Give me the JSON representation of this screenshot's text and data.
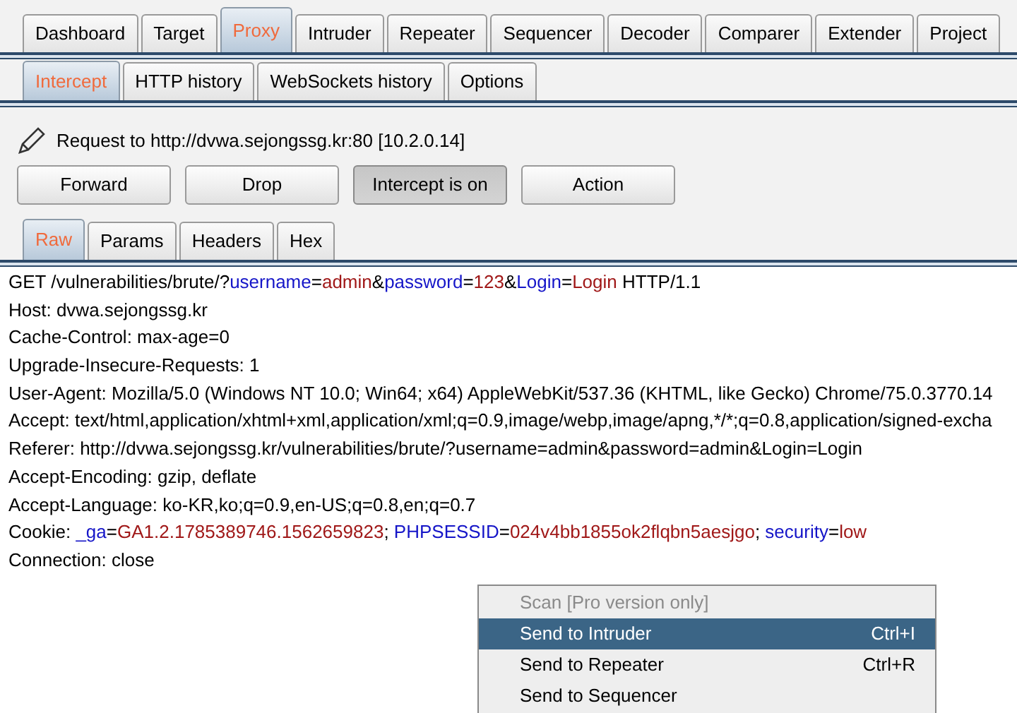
{
  "main_tabs": [
    {
      "label": "Dashboard",
      "selected": false
    },
    {
      "label": "Target",
      "selected": false
    },
    {
      "label": "Proxy",
      "selected": true
    },
    {
      "label": "Intruder",
      "selected": false
    },
    {
      "label": "Repeater",
      "selected": false
    },
    {
      "label": "Sequencer",
      "selected": false
    },
    {
      "label": "Decoder",
      "selected": false
    },
    {
      "label": "Comparer",
      "selected": false
    },
    {
      "label": "Extender",
      "selected": false
    },
    {
      "label": "Project",
      "selected": false
    }
  ],
  "proxy_tabs": [
    {
      "label": "Intercept",
      "selected": true
    },
    {
      "label": "HTTP history",
      "selected": false
    },
    {
      "label": "WebSockets history",
      "selected": false
    },
    {
      "label": "Options",
      "selected": false
    }
  ],
  "request_info": "Request to http://dvwa.sejongssg.kr:80  [10.2.0.14]",
  "buttons": [
    {
      "label": "Forward",
      "pressed": false
    },
    {
      "label": "Drop",
      "pressed": false
    },
    {
      "label": "Intercept is on",
      "pressed": true
    },
    {
      "label": "Action",
      "pressed": false
    }
  ],
  "editor_tabs": [
    {
      "label": "Raw",
      "selected": true
    },
    {
      "label": "Params",
      "selected": false
    },
    {
      "label": "Headers",
      "selected": false
    },
    {
      "label": "Hex",
      "selected": false
    }
  ],
  "request_lines": [
    [
      {
        "kind": "plain",
        "text": "GET /vulnerabilities/brute/?"
      },
      {
        "kind": "name",
        "text": "username"
      },
      {
        "kind": "plain",
        "text": "="
      },
      {
        "kind": "value",
        "text": "admin"
      },
      {
        "kind": "plain",
        "text": "&"
      },
      {
        "kind": "name",
        "text": "password"
      },
      {
        "kind": "plain",
        "text": "="
      },
      {
        "kind": "value",
        "text": "123"
      },
      {
        "kind": "plain",
        "text": "&"
      },
      {
        "kind": "name",
        "text": "Login"
      },
      {
        "kind": "plain",
        "text": "="
      },
      {
        "kind": "value",
        "text": "Login"
      },
      {
        "kind": "plain",
        "text": " HTTP/1.1"
      }
    ],
    [
      {
        "kind": "plain",
        "text": "Host: dvwa.sejongssg.kr"
      }
    ],
    [
      {
        "kind": "plain",
        "text": "Cache-Control: max-age=0"
      }
    ],
    [
      {
        "kind": "plain",
        "text": "Upgrade-Insecure-Requests: 1"
      }
    ],
    [
      {
        "kind": "plain",
        "text": "User-Agent: Mozilla/5.0 (Windows NT 10.0; Win64; x64) AppleWebKit/537.36 (KHTML, like Gecko) Chrome/75.0.3770.14"
      }
    ],
    [
      {
        "kind": "plain",
        "text": "Accept: text/html,application/xhtml+xml,application/xml;q=0.9,image/webp,image/apng,*/*;q=0.8,application/signed-excha"
      }
    ],
    [
      {
        "kind": "plain",
        "text": "Referer: http://dvwa.sejongssg.kr/vulnerabilities/brute/?username=admin&password=admin&Login=Login"
      }
    ],
    [
      {
        "kind": "plain",
        "text": "Accept-Encoding: gzip, deflate"
      }
    ],
    [
      {
        "kind": "plain",
        "text": "Accept-Language: ko-KR,ko;q=0.9,en-US;q=0.8,en;q=0.7"
      }
    ],
    [
      {
        "kind": "plain",
        "text": "Cookie: "
      },
      {
        "kind": "name",
        "text": "_ga"
      },
      {
        "kind": "plain",
        "text": "="
      },
      {
        "kind": "value",
        "text": "GA1.2.1785389746.1562659823"
      },
      {
        "kind": "plain",
        "text": "; "
      },
      {
        "kind": "name",
        "text": "PHPSESSID"
      },
      {
        "kind": "plain",
        "text": "="
      },
      {
        "kind": "value",
        "text": "024v4bb1855ok2flqbn5aesjgo"
      },
      {
        "kind": "plain",
        "text": "; "
      },
      {
        "kind": "name",
        "text": "security"
      },
      {
        "kind": "plain",
        "text": "="
      },
      {
        "kind": "value",
        "text": "low"
      }
    ],
    [
      {
        "kind": "plain",
        "text": "Connection: close"
      }
    ]
  ],
  "context_menu": [
    {
      "label": "Scan [Pro version only]",
      "disabled": true,
      "selected": false
    },
    {
      "label": "Send to Intruder",
      "shortcut": "Ctrl+I",
      "disabled": false,
      "selected": true
    },
    {
      "label": "Send to Repeater",
      "shortcut": "Ctrl+R",
      "disabled": false,
      "selected": false
    },
    {
      "label": "Send to Sequencer",
      "disabled": false,
      "selected": false
    }
  ]
}
